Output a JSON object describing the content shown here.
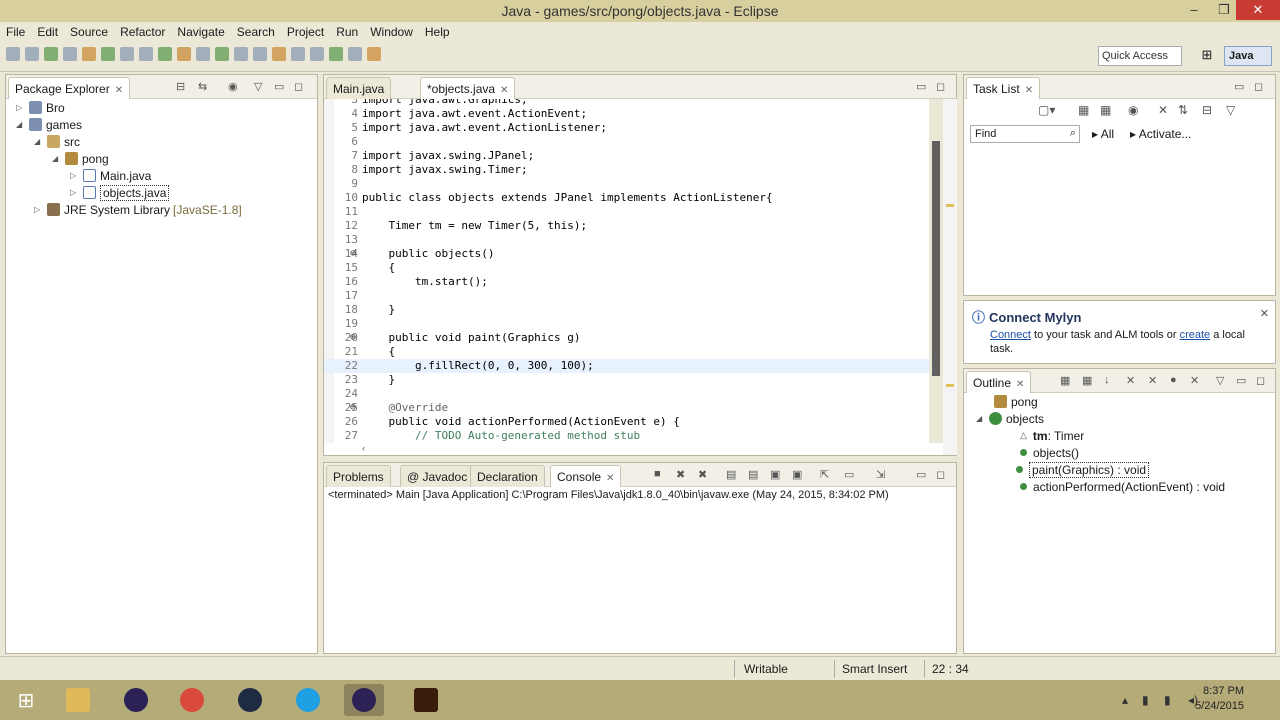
{
  "window": {
    "title": "Java - games/src/pong/objects.java - Eclipse",
    "min": "–",
    "max": "❐",
    "close": "✕"
  },
  "menu": [
    "File",
    "Edit",
    "Source",
    "Refactor",
    "Navigate",
    "Search",
    "Project",
    "Run",
    "Window",
    "Help"
  ],
  "toolbar": {
    "quick_access": "Quick Access",
    "perspective_java": "Java"
  },
  "package_explorer": {
    "tab": "Package Explorer",
    "tree": [
      {
        "label": "Bro",
        "twisty": "▷"
      },
      {
        "label": "games",
        "twisty": "◢"
      },
      {
        "label": "src",
        "twisty": "◢"
      },
      {
        "label": "pong",
        "twisty": "◢"
      },
      {
        "label": "Main.java",
        "twisty": "▷"
      },
      {
        "label": "objects.java",
        "twisty": "▷"
      },
      {
        "label": "JRE System Library",
        "suffix": "[JavaSE-1.8]",
        "twisty": "▷"
      }
    ]
  },
  "editor": {
    "tabs": [
      {
        "label": "Main.java"
      },
      {
        "label": "*objects.java"
      }
    ],
    "lines": [
      {
        "n": "3",
        "text": "import java.awt.Graphics;"
      },
      {
        "n": "4",
        "text": "import java.awt.event.ActionEvent;"
      },
      {
        "n": "5",
        "text": "import java.awt.event.ActionListener;"
      },
      {
        "n": "6",
        "text": ""
      },
      {
        "n": "7",
        "text": "import javax.swing.JPanel;"
      },
      {
        "n": "8",
        "text": "import javax.swing.Timer;"
      },
      {
        "n": "9",
        "text": ""
      },
      {
        "n": "10",
        "text": "public class objects extends JPanel implements ActionListener{"
      },
      {
        "n": "11",
        "text": ""
      },
      {
        "n": "12",
        "text": "    Timer tm = new Timer(5, this);"
      },
      {
        "n": "13",
        "text": ""
      },
      {
        "n": "14",
        "text": "    public objects()",
        "fold": "⊖"
      },
      {
        "n": "15",
        "text": "    {"
      },
      {
        "n": "16",
        "text": "        tm.start();"
      },
      {
        "n": "17",
        "text": ""
      },
      {
        "n": "18",
        "text": "    }"
      },
      {
        "n": "19",
        "text": ""
      },
      {
        "n": "20",
        "text": "    public void paint(Graphics g)",
        "fold": "⊖"
      },
      {
        "n": "21",
        "text": "    {"
      },
      {
        "n": "22",
        "text": "        g.fillRect(0, 0, 300, 100);"
      },
      {
        "n": "23",
        "text": "    }"
      },
      {
        "n": "24",
        "text": ""
      },
      {
        "n": "25",
        "text": "    @Override",
        "fold": "⊖"
      },
      {
        "n": "26",
        "text": "    public void actionPerformed(ActionEvent e) {"
      },
      {
        "n": "27",
        "text": "        // TODO Auto-generated method stub"
      }
    ]
  },
  "bottom": {
    "tabs": [
      {
        "label": "Problems"
      },
      {
        "label": "@ Javadoc"
      },
      {
        "label": "Declaration"
      },
      {
        "label": "Console"
      }
    ],
    "console_status": "<terminated> Main [Java Application] C:\\Program Files\\Java\\jdk1.8.0_40\\bin\\javaw.exe (May 24, 2015, 8:34:02 PM)"
  },
  "task_list": {
    "tab": "Task List",
    "find_placeholder": "Find",
    "all": "All",
    "activate": "Activate..."
  },
  "mylyn": {
    "title": "Connect Mylyn",
    "connect": "Connect",
    "text1": " to your task and ALM tools or ",
    "create": "create",
    "text2": " a local task."
  },
  "outline": {
    "tab": "Outline",
    "items": [
      {
        "label": "pong"
      },
      {
        "label": "objects"
      },
      {
        "name": "tm",
        "type": " : Timer"
      },
      {
        "label": "objects()"
      },
      {
        "label": "paint(Graphics) : void"
      },
      {
        "label": "actionPerformed(ActionEvent) : void"
      }
    ]
  },
  "status": {
    "writable": "Writable",
    "insert": "Smart Insert",
    "position": "22 : 34"
  },
  "clock": {
    "time": "8:37 PM",
    "date": "5/24/2015"
  },
  "colors": {
    "keyword": "#7f0055",
    "comment": "#3f7f5f",
    "taskbar": "#b4ab79"
  }
}
